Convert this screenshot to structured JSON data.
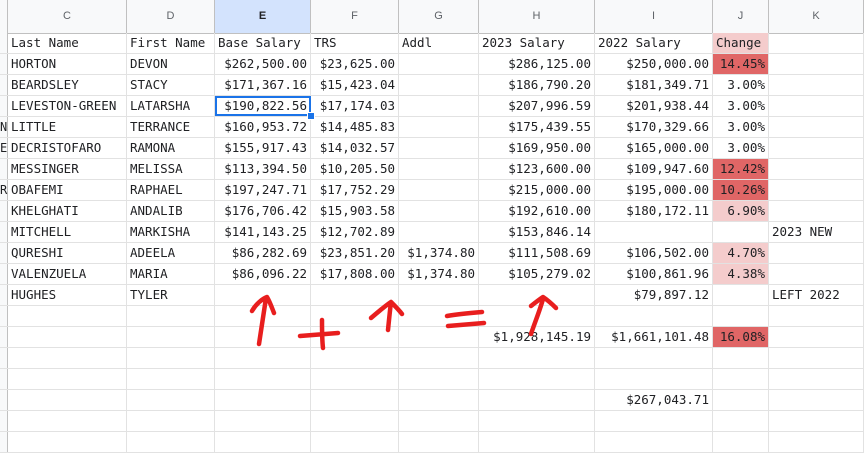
{
  "columns": [
    "C",
    "D",
    "E",
    "F",
    "G",
    "H",
    "I",
    "J",
    "K"
  ],
  "active_column": "E",
  "colors": {
    "change_strong": "#e06666",
    "change_light": "#f4cccc",
    "ink": "#e81e1e",
    "selection": "#1a73e8"
  },
  "rows": [
    {
      "frag": "",
      "last": "Last Name",
      "first": "First Name",
      "base": "Base Salary",
      "trs": "TRS",
      "addl": "Addl",
      "s2023": "2023 Salary",
      "s2022": "2022 Salary",
      "change": "Change",
      "note": "",
      "header": true
    },
    {
      "frag": "",
      "last": "HORTON",
      "first": "DEVON",
      "base": "$262,500.00",
      "trs": "$23,625.00",
      "addl": "",
      "s2023": "$286,125.00",
      "s2022": "$250,000.00",
      "change": "14.45%",
      "note": "",
      "shade": "strong"
    },
    {
      "frag": "",
      "last": "BEARDSLEY",
      "first": "STACY",
      "base": "$171,367.16",
      "trs": "$15,423.04",
      "addl": "",
      "s2023": "$186,790.20",
      "s2022": "$181,349.71",
      "change": "3.00%",
      "note": ""
    },
    {
      "frag": "",
      "last": "LEVESTON-GREEN",
      "first": "LATARSHA",
      "base": "$190,822.56",
      "trs": "$17,174.03",
      "addl": "",
      "s2023": "$207,996.59",
      "s2022": "$201,938.44",
      "change": "3.00%",
      "note": "",
      "selected": true
    },
    {
      "frag": "N",
      "last": "LITTLE",
      "first": "TERRANCE",
      "base": "$160,953.72",
      "trs": "$14,485.83",
      "addl": "",
      "s2023": "$175,439.55",
      "s2022": "$170,329.66",
      "change": "3.00%",
      "note": ""
    },
    {
      "frag": "E",
      "last": "DECRISTOFARO",
      "first": "RAMONA",
      "base": "$155,917.43",
      "trs": "$14,032.57",
      "addl": "",
      "s2023": "$169,950.00",
      "s2022": "$165,000.00",
      "change": "3.00%",
      "note": ""
    },
    {
      "frag": "",
      "last": "MESSINGER",
      "first": "MELISSA",
      "base": "$113,394.50",
      "trs": "$10,205.50",
      "addl": "",
      "s2023": "$123,600.00",
      "s2022": "$109,947.60",
      "change": "12.42%",
      "note": "",
      "shade": "strong"
    },
    {
      "frag": "R",
      "last": "OBAFEMI",
      "first": "RAPHAEL",
      "base": "$197,247.71",
      "trs": "$17,752.29",
      "addl": "",
      "s2023": "$215,000.00",
      "s2022": "$195,000.00",
      "change": "10.26%",
      "note": "",
      "shade": "strong"
    },
    {
      "frag": "",
      "last": "KHELGHATI",
      "first": "ANDALIB",
      "base": "$176,706.42",
      "trs": "$15,903.58",
      "addl": "",
      "s2023": "$192,610.00",
      "s2022": "$180,172.11",
      "change": "6.90%",
      "note": "",
      "shade": "light"
    },
    {
      "frag": "",
      "last": "MITCHELL",
      "first": "MARKISHA",
      "base": "$141,143.25",
      "trs": "$12,702.89",
      "addl": "",
      "s2023": "$153,846.14",
      "s2022": "",
      "change": "",
      "note": "2023 NEW"
    },
    {
      "frag": "",
      "last": "QURESHI",
      "first": "ADEELA",
      "base": "$86,282.69",
      "trs": "$23,851.20",
      "addl": "$1,374.80",
      "s2023": "$111,508.69",
      "s2022": "$106,502.00",
      "change": "4.70%",
      "note": "",
      "shade": "light"
    },
    {
      "frag": "",
      "last": "VALENZUELA",
      "first": "MARIA",
      "base": "$86,096.22",
      "trs": "$17,808.00",
      "addl": "$1,374.80",
      "s2023": "$105,279.02",
      "s2022": "$100,861.96",
      "change": "4.38%",
      "note": "",
      "shade": "light"
    },
    {
      "frag": "",
      "last": "HUGHES",
      "first": "TYLER",
      "base": "",
      "trs": "",
      "addl": "",
      "s2023": "",
      "s2022": "$79,897.12",
      "change": "",
      "note": "LEFT 2022"
    },
    {
      "frag": "",
      "last": "",
      "first": "",
      "base": "",
      "trs": "",
      "addl": "",
      "s2023": "",
      "s2022": "",
      "change": "",
      "note": ""
    },
    {
      "frag": "",
      "last": "",
      "first": "",
      "base": "",
      "trs": "",
      "addl": "",
      "s2023": "$1,928,145.19",
      "s2022": "$1,661,101.48",
      "change": "16.08%",
      "note": "",
      "shade": "strong"
    },
    {
      "frag": "",
      "last": "",
      "first": "",
      "base": "",
      "trs": "",
      "addl": "",
      "s2023": "",
      "s2022": "",
      "change": "",
      "note": ""
    },
    {
      "frag": "",
      "last": "",
      "first": "",
      "base": "",
      "trs": "",
      "addl": "",
      "s2023": "",
      "s2022": "",
      "change": "",
      "note": ""
    },
    {
      "frag": "",
      "last": "",
      "first": "",
      "base": "",
      "trs": "",
      "addl": "",
      "s2023": "",
      "s2022": "$267,043.71",
      "change": "",
      "note": ""
    },
    {
      "frag": "",
      "last": "",
      "first": "",
      "base": "",
      "trs": "",
      "addl": "",
      "s2023": "",
      "s2022": "",
      "change": "",
      "note": ""
    },
    {
      "frag": "",
      "last": "",
      "first": "",
      "base": "",
      "trs": "",
      "addl": "",
      "s2023": "",
      "s2022": "",
      "change": "",
      "note": ""
    }
  ],
  "annotation": {
    "symbols": [
      "arrow-up",
      "plus",
      "arrow-up",
      "equals",
      "arrow-up"
    ]
  }
}
